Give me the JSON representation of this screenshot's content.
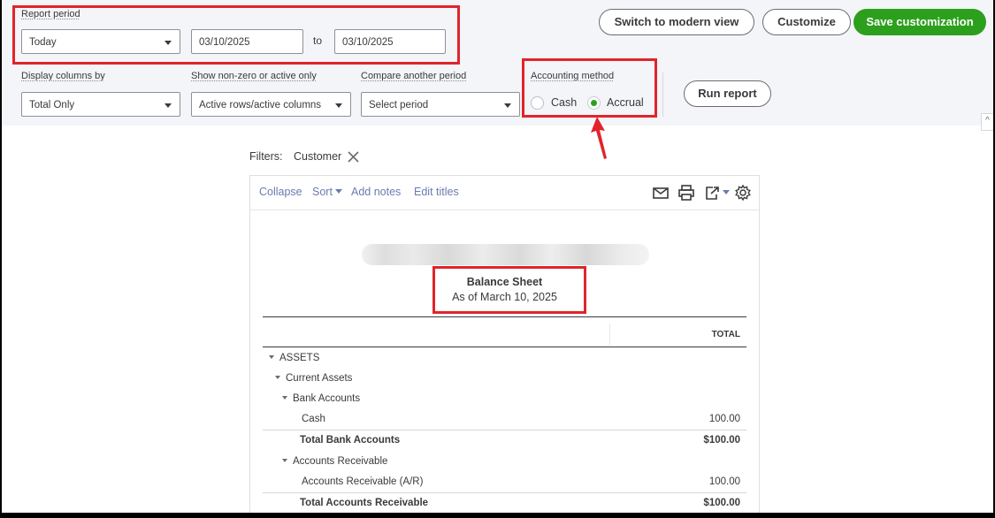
{
  "report_period": {
    "label": "Report period",
    "preset": "Today",
    "from_date": "03/10/2025",
    "to_label": "to",
    "to_date": "03/10/2025"
  },
  "header_buttons": {
    "modern_view": "Switch to modern view",
    "customize": "Customize",
    "save": "Save customization"
  },
  "display_columns": {
    "label": "Display columns by",
    "value": "Total Only"
  },
  "non_zero": {
    "label": "Show non-zero or active only",
    "value": "Active rows/active columns"
  },
  "compare": {
    "label": "Compare another period",
    "value": "Select period"
  },
  "accounting_method": {
    "label": "Accounting method",
    "options": [
      "Cash",
      "Accrual"
    ],
    "selected": "Accrual"
  },
  "run_report": "Run report",
  "filters": {
    "label": "Filters:",
    "chip": "Customer"
  },
  "report_toolbar": {
    "collapse": "Collapse",
    "sort": "Sort",
    "add_notes": "Add notes",
    "edit_titles": "Edit titles"
  },
  "report": {
    "title": "Balance Sheet",
    "subtitle": "As of March 10, 2025",
    "total_header": "TOTAL",
    "rows": [
      {
        "name": "ASSETS",
        "amount": ""
      },
      {
        "name": "Current Assets",
        "amount": ""
      },
      {
        "name": "Bank Accounts",
        "amount": ""
      },
      {
        "name": "Cash",
        "amount": "100.00"
      },
      {
        "name": "Total Bank Accounts",
        "amount": "$100.00"
      },
      {
        "name": "Accounts Receivable",
        "amount": ""
      },
      {
        "name": "Accounts Receivable (A/R)",
        "amount": "100.00"
      },
      {
        "name": "Total Accounts Receivable",
        "amount": "$100.00"
      }
    ]
  },
  "colors": {
    "accent_green": "#2ca01c",
    "highlight_red": "#e0242b",
    "link_blue": "#6b7bb0"
  }
}
